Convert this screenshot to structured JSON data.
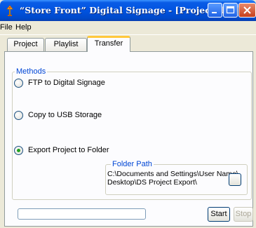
{
  "window": {
    "title": "“Store Front” Digital Signage - [Project.dsg]"
  },
  "menu": {
    "file": "File",
    "help": "Help"
  },
  "tabs": [
    {
      "label": "Project"
    },
    {
      "label": "Playlist"
    },
    {
      "label": "Transfer"
    }
  ],
  "active_tab": "Transfer",
  "methods": {
    "label": "Methods",
    "options": [
      {
        "label": "FTP to Digital Signage",
        "selected": false
      },
      {
        "label": "Copy to USB Storage",
        "selected": false
      },
      {
        "label": "Export Project to Folder",
        "selected": true
      }
    ]
  },
  "folder_path": {
    "label": "Folder Path",
    "line1": "C:\\Documents and Settings\\User Name\\",
    "line2": "Desktop\\DS Project Export\\"
  },
  "progress": {
    "value": 0
  },
  "buttons": {
    "start": "Start",
    "stop": "Stop"
  },
  "colors": {
    "title_bar": "#0053e0",
    "accent": "#0046d5",
    "active_tab": "#ffc83c",
    "radio_dot": "#21a121"
  }
}
